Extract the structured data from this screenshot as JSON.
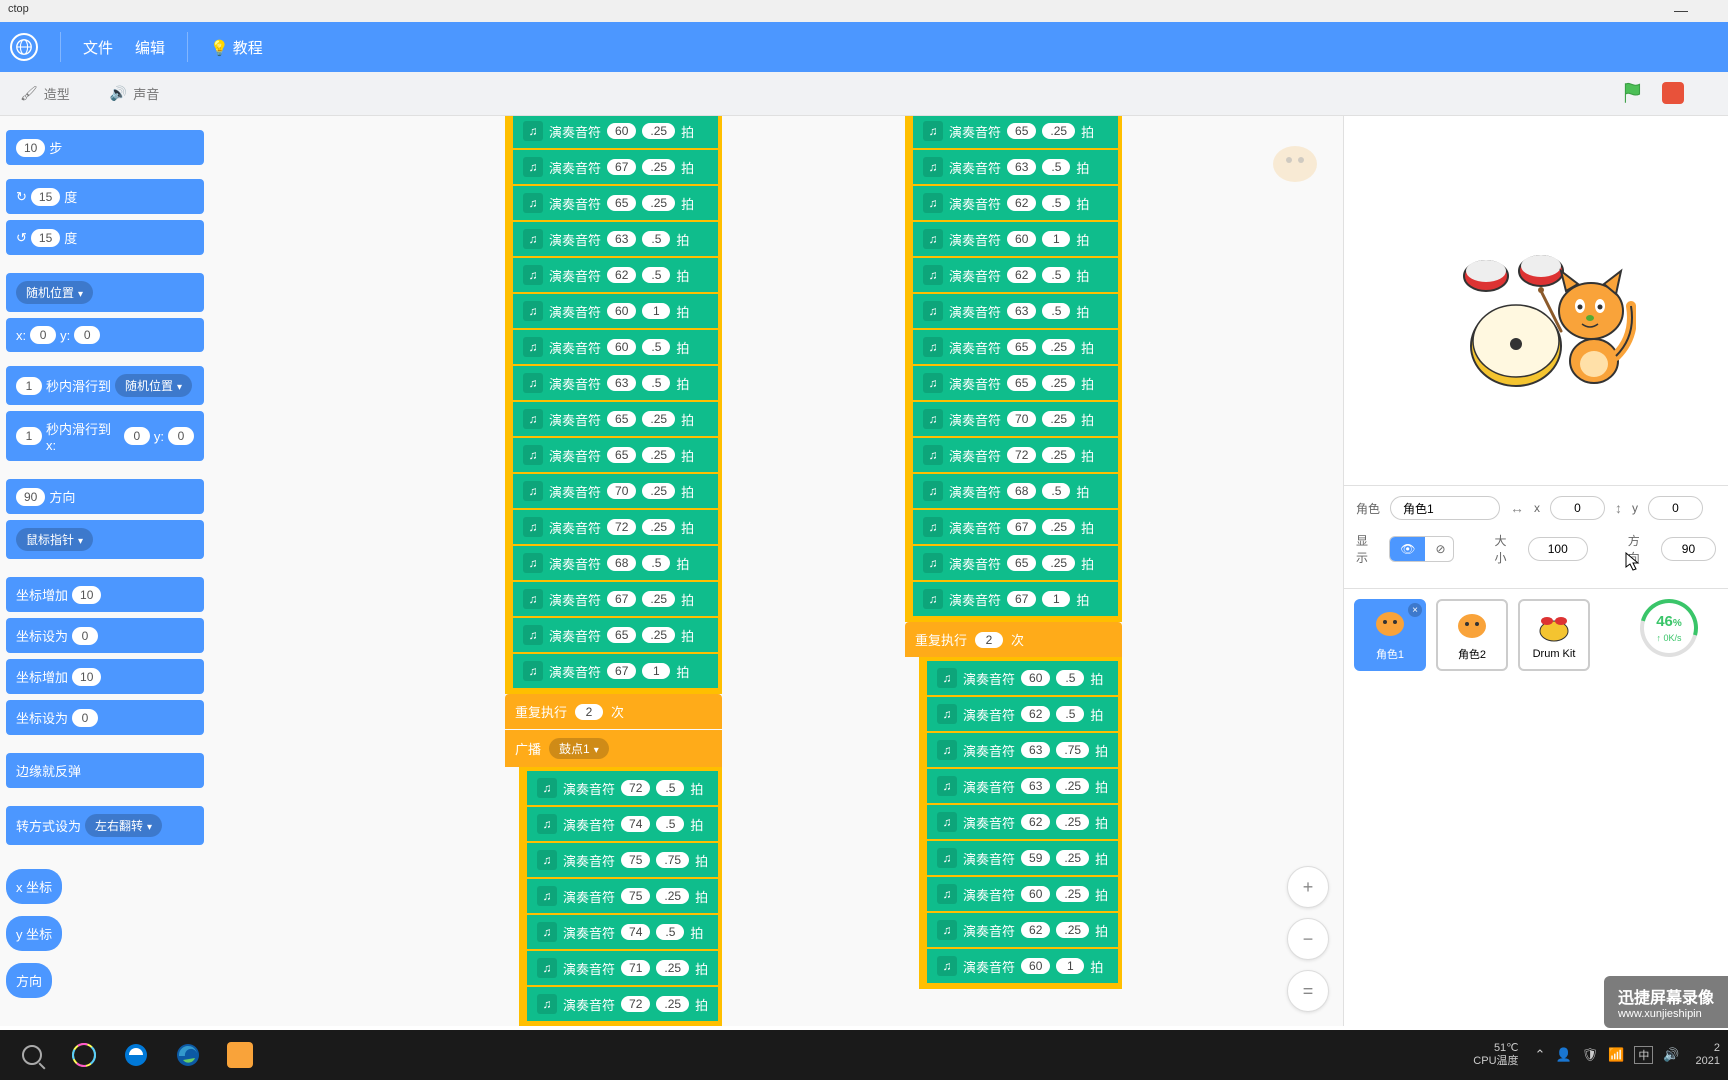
{
  "title": "ctop",
  "menu": {
    "file": "文件",
    "edit": "编辑",
    "tutorial": "教程"
  },
  "tabs": {
    "costume": "造型",
    "sound": "声音"
  },
  "palette": {
    "move": {
      "val": "10",
      "suffix": "步"
    },
    "turn_r": {
      "val": "15",
      "suffix": "度"
    },
    "turn_l": {
      "val": "15",
      "suffix": "度"
    },
    "goto_rand": "随机位置",
    "goto_xy": {
      "x": "0",
      "y": "0"
    },
    "glide_rand": {
      "sec": "1",
      "mid": "秒内滑行到",
      "target": "随机位置"
    },
    "glide_xy": {
      "sec": "1",
      "mid": "秒内滑行到 x:",
      "x": "0",
      "y_lbl": "y:",
      "y": "0"
    },
    "point_dir": {
      "val": "90",
      "suffix": "方向"
    },
    "point_to": "鼠标指针",
    "change_x": {
      "lbl": "坐标增加",
      "val": "10"
    },
    "set_x": {
      "lbl": "坐标设为",
      "val": "0"
    },
    "change_y": {
      "lbl": "坐标增加",
      "val": "10"
    },
    "set_y": {
      "lbl": "坐标设为",
      "val": "0"
    },
    "bounce": "边缘就反弹",
    "rot_style": {
      "lbl": "转方式设为",
      "val": "左右翻转"
    },
    "x_pos": "x 坐标",
    "y_pos": "y 坐标",
    "direction": "方向"
  },
  "stack1": {
    "blocks": [
      {
        "n": "60",
        "b": ".25"
      },
      {
        "n": "67",
        "b": ".25"
      },
      {
        "n": "65",
        "b": ".25"
      },
      {
        "n": "63",
        "b": ".5"
      },
      {
        "n": "62",
        "b": ".5"
      },
      {
        "n": "60",
        "b": "1"
      },
      {
        "n": "60",
        "b": ".5"
      },
      {
        "n": "63",
        "b": ".5"
      },
      {
        "n": "65",
        "b": ".25"
      },
      {
        "n": "65",
        "b": ".25"
      },
      {
        "n": "70",
        "b": ".25"
      },
      {
        "n": "72",
        "b": ".25"
      },
      {
        "n": "68",
        "b": ".5"
      },
      {
        "n": "67",
        "b": ".25"
      },
      {
        "n": "65",
        "b": ".25"
      },
      {
        "n": "67",
        "b": "1"
      }
    ],
    "repeat_lbl": "重复执行",
    "repeat_n": "2",
    "repeat_suffix": "次",
    "broadcast_lbl": "广播",
    "broadcast_msg": "鼓点1",
    "blocks2": [
      {
        "n": "72",
        "b": ".5"
      },
      {
        "n": "74",
        "b": ".5"
      },
      {
        "n": "75",
        "b": ".75"
      },
      {
        "n": "75",
        "b": ".25"
      },
      {
        "n": "74",
        "b": ".5"
      },
      {
        "n": "71",
        "b": ".25"
      },
      {
        "n": "72",
        "b": ".25"
      }
    ]
  },
  "stack2": {
    "blocks": [
      {
        "n": "65",
        "b": ".25"
      },
      {
        "n": "63",
        "b": ".5"
      },
      {
        "n": "62",
        "b": ".5"
      },
      {
        "n": "60",
        "b": "1"
      },
      {
        "n": "62",
        "b": ".5"
      },
      {
        "n": "63",
        "b": ".5"
      },
      {
        "n": "65",
        "b": ".25"
      },
      {
        "n": "65",
        "b": ".25"
      },
      {
        "n": "70",
        "b": ".25"
      },
      {
        "n": "72",
        "b": ".25"
      },
      {
        "n": "68",
        "b": ".5"
      },
      {
        "n": "67",
        "b": ".25"
      },
      {
        "n": "65",
        "b": ".25"
      },
      {
        "n": "67",
        "b": "1"
      }
    ],
    "repeat_lbl": "重复执行",
    "repeat_n": "2",
    "repeat_suffix": "次",
    "blocks2": [
      {
        "n": "60",
        "b": ".5"
      },
      {
        "n": "62",
        "b": ".5"
      },
      {
        "n": "63",
        "b": ".75"
      },
      {
        "n": "63",
        "b": ".25"
      },
      {
        "n": "62",
        "b": ".25"
      },
      {
        "n": "59",
        "b": ".25"
      },
      {
        "n": "60",
        "b": ".25"
      },
      {
        "n": "62",
        "b": ".25"
      },
      {
        "n": "60",
        "b": "1"
      }
    ]
  },
  "play_label": "演奏音符",
  "beat_suffix": "拍",
  "sprite_info": {
    "sprite_lbl": "角色",
    "name": "角色1",
    "x_lbl": "x",
    "x": "0",
    "y_lbl": "y",
    "y": "0",
    "show_lbl": "显示",
    "size_lbl": "大小",
    "size": "100",
    "dir_lbl": "方向",
    "dir": "90"
  },
  "sprites": [
    {
      "name": "角色1",
      "selected": true
    },
    {
      "name": "角色2",
      "selected": false
    },
    {
      "name": "Drum Kit",
      "selected": false
    }
  ],
  "gauge": {
    "val": "46",
    "pct": "%",
    "sub": "↑ 0K/s"
  },
  "watermark": {
    "line1": "迅捷屏幕录像",
    "line2": "www.xunjieshipin"
  },
  "taskbar": {
    "temp": "51℃",
    "temp_lbl": "CPU温度",
    "ime": "中",
    "date1": "2",
    "date2": "2021"
  }
}
